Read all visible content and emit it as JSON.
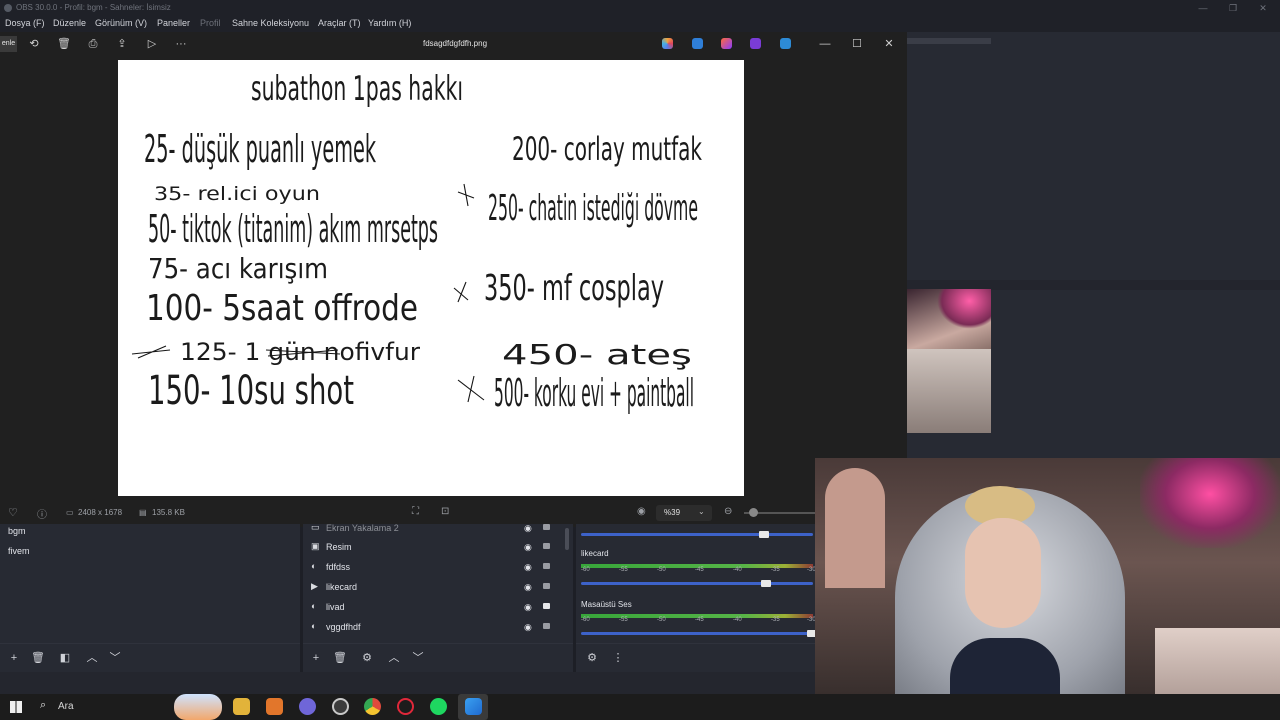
{
  "obs": {
    "window_title": "OBS 30.0.0 - Profil: bgm - Sahneler: İsimsiz",
    "menu": [
      "Dosya (F)",
      "Düzenle",
      "Görünüm (V)",
      "Paneller",
      "Profil",
      "Sahne Koleksiyonu",
      "Araçlar (T)",
      "Yardım (H)"
    ],
    "scenes": [
      "bgm",
      "fivem"
    ],
    "sources": [
      {
        "name": "Ekran Yakalama 2",
        "icon": "monitor-icon",
        "locked": false
      },
      {
        "name": "Resim",
        "icon": "image-icon",
        "locked": false
      },
      {
        "name": "fdfdss",
        "icon": "browser-icon",
        "locked": false
      },
      {
        "name": "likecard",
        "icon": "play-icon",
        "locked": false
      },
      {
        "name": "livad",
        "icon": "browser-icon",
        "locked": true
      },
      {
        "name": "vggdfhdf",
        "icon": "browser-icon",
        "locked": false
      }
    ],
    "audio": [
      {
        "label": "likecard",
        "volume": 0.8
      },
      {
        "label": "Masaüstü Ses",
        "volume": 1.0
      }
    ],
    "meter_ticks": [
      "-60",
      "-55",
      "-50",
      "-45",
      "-40",
      "-35",
      "-30"
    ]
  },
  "viewer": {
    "left_button_label": "enle",
    "file_name": "fdsagdfdgfdfh.png",
    "dimensions": "2408 x 1678",
    "file_size": "135.8 KB",
    "zoom": "%39",
    "zoom_fraction": 0.05,
    "image_text": {
      "title": "subathon 1pas hakkı",
      "left": [
        "25- düşük puanlı yemek",
        "35- rel.ici oyun",
        "50- tiktok (titanim) akım mrsetps",
        "75- acı karışım",
        "100- 5saat offrode",
        "125- 1 gün nofivfur",
        "150- 10su shot"
      ],
      "right": [
        "200- corlay mutfak",
        "250- chatin istediği dövme",
        "350- mf cosplay",
        "450- ateş",
        "500- korku evi + paintball"
      ]
    }
  },
  "taskbar": {
    "search_placeholder": "Ara"
  }
}
